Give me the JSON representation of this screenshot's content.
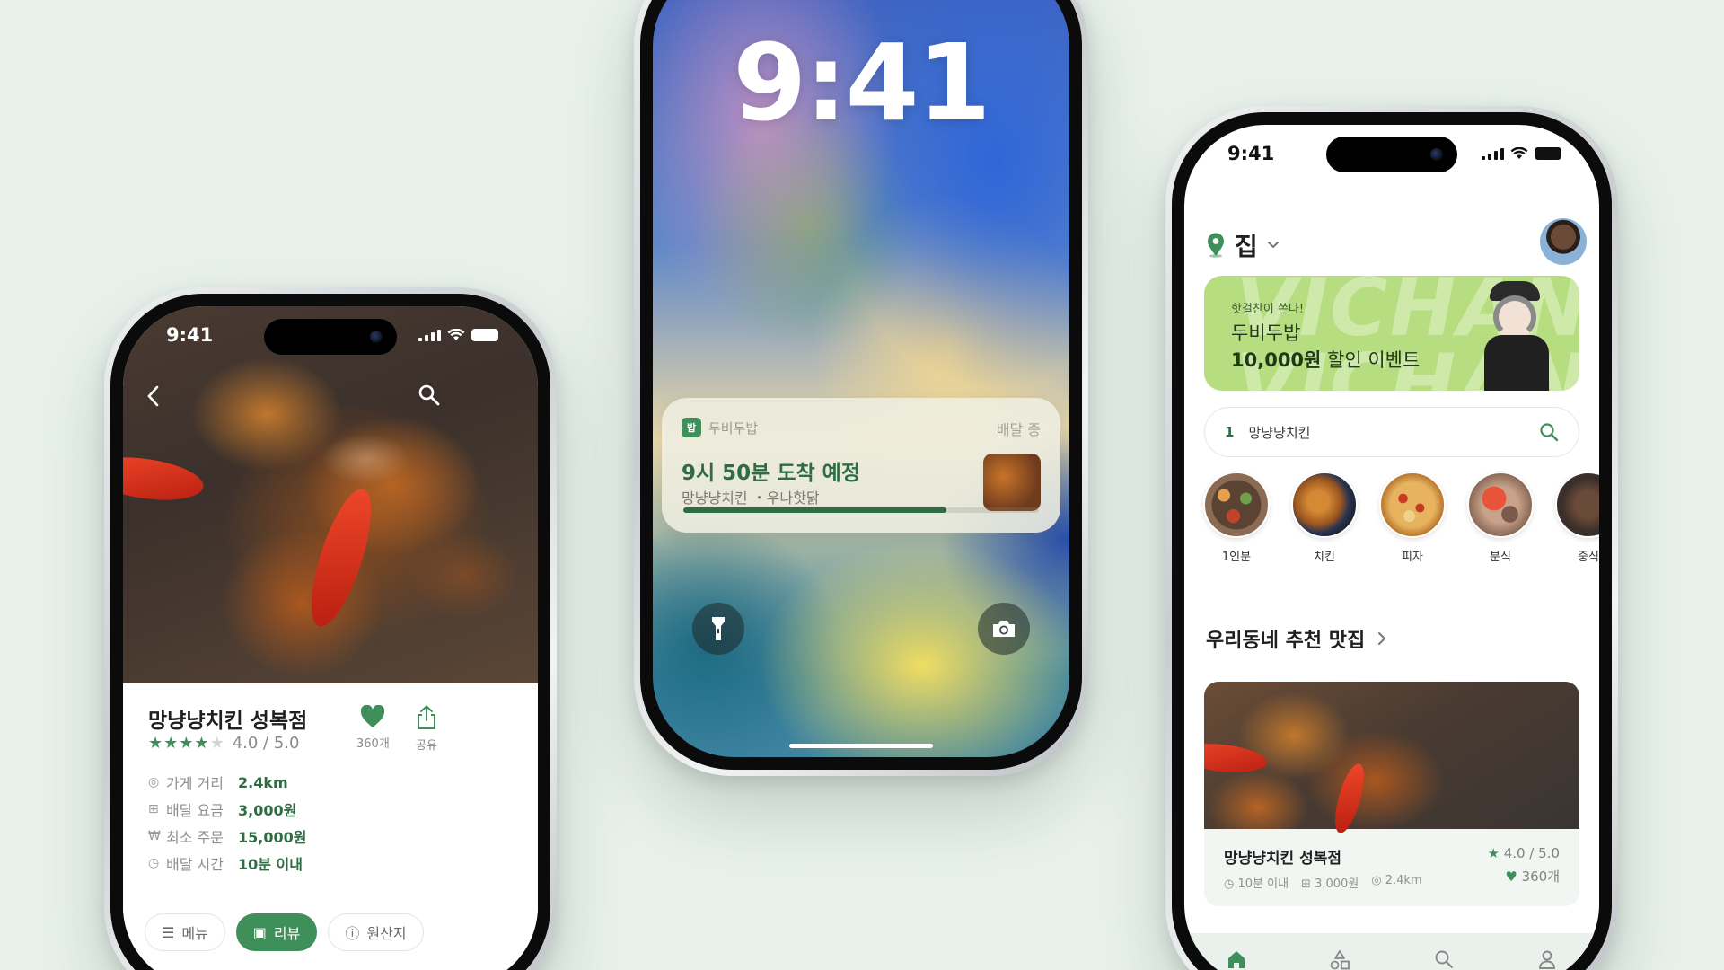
{
  "colors": {
    "accent": "#3f8f5a",
    "accent_dark": "#2e6c44",
    "background": "#e9f1ec",
    "banner": "#b6dd7f"
  },
  "detail_phone": {
    "time": "9:41",
    "store_name": "망냥냥치킨 성복점",
    "rating_text": "4.0 / 5.0",
    "stars_filled": 4,
    "stars_total": 5,
    "like_count": "360개",
    "share_label": "공유",
    "info": [
      {
        "icon": "distance-icon",
        "label": "가게 거리",
        "value": "2.4km"
      },
      {
        "icon": "delivery-fee-icon",
        "label": "배달 요금",
        "value": "3,000원"
      },
      {
        "icon": "min-order-icon",
        "label": "최소 주문",
        "value": "15,000원"
      },
      {
        "icon": "delivery-time-icon",
        "label": "배달 시간",
        "value": "10분 이내"
      }
    ],
    "tabs": [
      {
        "label": "메뉴",
        "active": false
      },
      {
        "label": "리뷰",
        "active": true
      },
      {
        "label": "원산지",
        "active": false
      }
    ]
  },
  "lock_phone": {
    "clock": "9:41",
    "notification": {
      "app_name": "두비두밥",
      "app_logo_text": "밥",
      "status": "배달 중",
      "title": "9시 50분 도착 예정",
      "subtitle": "망냥냥치킨 ・우나핫닭",
      "progress": 0.74
    }
  },
  "home_phone": {
    "time": "9:41",
    "location": "집",
    "banner": {
      "small": "핫걸찬이 쏜다!",
      "line2": "두비두밥",
      "line3_bold": "10,000원",
      "line3_rest": " 할인 이벤트",
      "bg_text_1": "VICHAN",
      "bg_text_2": "VICHAN"
    },
    "search": {
      "rank": "1",
      "query": "망냥냥치킨"
    },
    "categories": [
      "1인분",
      "치킨",
      "피자",
      "분식",
      "중식"
    ],
    "section_title": "우리동네 추천 맛집",
    "card": {
      "name": "망냥냥치킨 성복점",
      "time": "10분 이내",
      "fee": "3,000원",
      "distance": "2.4km",
      "rating": "4.0 / 5.0",
      "likes": "360개"
    },
    "tabbar": [
      "home-icon",
      "category-icon",
      "search-icon",
      "profile-icon"
    ]
  }
}
